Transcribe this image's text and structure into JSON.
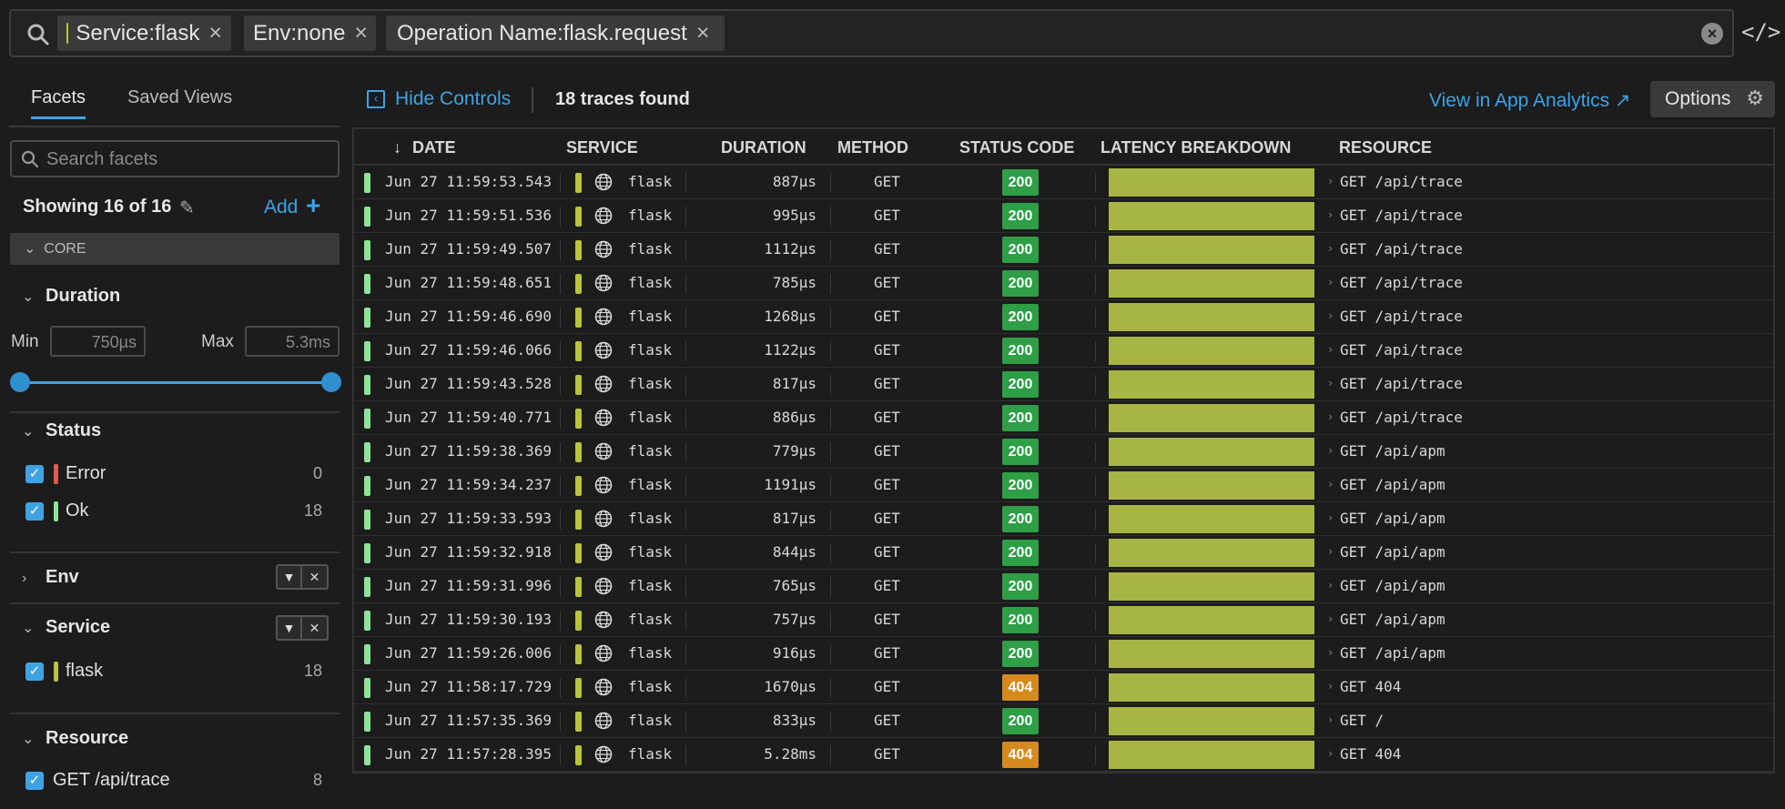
{
  "search": {
    "chips": [
      {
        "label": "Service:flask"
      },
      {
        "label": "Env:none"
      },
      {
        "label": "Operation Name:flask.request"
      }
    ]
  },
  "sidebar": {
    "tabs": [
      "Facets",
      "Saved Views"
    ],
    "search_placeholder": "Search facets",
    "showing": "Showing 16 of 16",
    "add_label": "Add",
    "core_label": "CORE",
    "duration": {
      "title": "Duration",
      "min_label": "Min",
      "min_value": "750µs",
      "max_label": "Max",
      "max_value": "5.3ms"
    },
    "status": {
      "title": "Status",
      "items": [
        {
          "label": "Error",
          "count": "0",
          "color": "#e05a4f"
        },
        {
          "label": "Ok",
          "count": "18",
          "color": "#8ee39a"
        }
      ]
    },
    "env": {
      "title": "Env"
    },
    "service": {
      "title": "Service",
      "items": [
        {
          "label": "flask",
          "count": "18",
          "color": "#b8c43c"
        }
      ]
    },
    "resource": {
      "title": "Resource",
      "items": [
        {
          "label": "GET /api/trace",
          "count": "8"
        }
      ]
    }
  },
  "toolbar": {
    "hide_controls": "Hide Controls",
    "traces_found": "18 traces found",
    "view_app_analytics": "View in App Analytics",
    "options": "Options"
  },
  "table": {
    "headers": {
      "date": "DATE",
      "service": "SERVICE",
      "duration": "DURATION",
      "method": "METHOD",
      "status_code": "STATUS CODE",
      "latency": "LATENCY BREAKDOWN",
      "resource": "RESOURCE"
    },
    "status_colors": {
      "200": "#2e9e47",
      "404": "#d68a1e"
    },
    "rows": [
      {
        "date": "Jun 27 11:59:53.543",
        "service": "flask",
        "duration": "887µs",
        "method": "GET",
        "status": "200",
        "resource": "GET /api/trace"
      },
      {
        "date": "Jun 27 11:59:51.536",
        "service": "flask",
        "duration": "995µs",
        "method": "GET",
        "status": "200",
        "resource": "GET /api/trace"
      },
      {
        "date": "Jun 27 11:59:49.507",
        "service": "flask",
        "duration": "1112µs",
        "method": "GET",
        "status": "200",
        "resource": "GET /api/trace"
      },
      {
        "date": "Jun 27 11:59:48.651",
        "service": "flask",
        "duration": "785µs",
        "method": "GET",
        "status": "200",
        "resource": "GET /api/trace"
      },
      {
        "date": "Jun 27 11:59:46.690",
        "service": "flask",
        "duration": "1268µs",
        "method": "GET",
        "status": "200",
        "resource": "GET /api/trace"
      },
      {
        "date": "Jun 27 11:59:46.066",
        "service": "flask",
        "duration": "1122µs",
        "method": "GET",
        "status": "200",
        "resource": "GET /api/trace"
      },
      {
        "date": "Jun 27 11:59:43.528",
        "service": "flask",
        "duration": "817µs",
        "method": "GET",
        "status": "200",
        "resource": "GET /api/trace"
      },
      {
        "date": "Jun 27 11:59:40.771",
        "service": "flask",
        "duration": "886µs",
        "method": "GET",
        "status": "200",
        "resource": "GET /api/trace"
      },
      {
        "date": "Jun 27 11:59:38.369",
        "service": "flask",
        "duration": "779µs",
        "method": "GET",
        "status": "200",
        "resource": "GET /api/apm"
      },
      {
        "date": "Jun 27 11:59:34.237",
        "service": "flask",
        "duration": "1191µs",
        "method": "GET",
        "status": "200",
        "resource": "GET /api/apm"
      },
      {
        "date": "Jun 27 11:59:33.593",
        "service": "flask",
        "duration": "817µs",
        "method": "GET",
        "status": "200",
        "resource": "GET /api/apm"
      },
      {
        "date": "Jun 27 11:59:32.918",
        "service": "flask",
        "duration": "844µs",
        "method": "GET",
        "status": "200",
        "resource": "GET /api/apm"
      },
      {
        "date": "Jun 27 11:59:31.996",
        "service": "flask",
        "duration": "765µs",
        "method": "GET",
        "status": "200",
        "resource": "GET /api/apm"
      },
      {
        "date": "Jun 27 11:59:30.193",
        "service": "flask",
        "duration": "757µs",
        "method": "GET",
        "status": "200",
        "resource": "GET /api/apm"
      },
      {
        "date": "Jun 27 11:59:26.006",
        "service": "flask",
        "duration": "916µs",
        "method": "GET",
        "status": "200",
        "resource": "GET /api/apm"
      },
      {
        "date": "Jun 27 11:58:17.729",
        "service": "flask",
        "duration": "1670µs",
        "method": "GET",
        "status": "404",
        "resource": "GET 404"
      },
      {
        "date": "Jun 27 11:57:35.369",
        "service": "flask",
        "duration": "833µs",
        "method": "GET",
        "status": "200",
        "resource": "GET /"
      },
      {
        "date": "Jun 27 11:57:28.395",
        "service": "flask",
        "duration": "5.28ms",
        "method": "GET",
        "status": "404",
        "resource": "GET 404"
      }
    ]
  }
}
